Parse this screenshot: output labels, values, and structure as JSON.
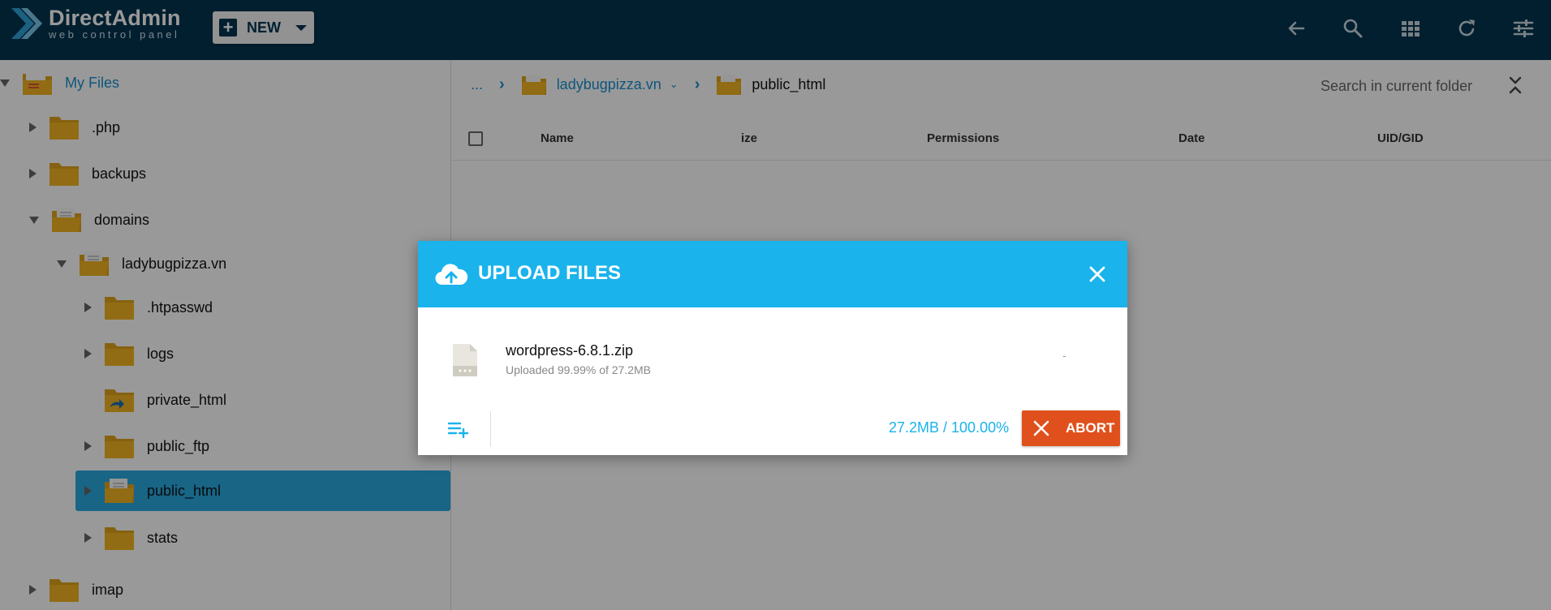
{
  "app": {
    "name": "DirectAdmin",
    "tagline": "web control panel",
    "new_button": "NEW"
  },
  "toolbar": {
    "icons": [
      "back-arrow-icon",
      "search-icon",
      "grid-view-icon",
      "refresh-icon",
      "settings-sliders-icon"
    ]
  },
  "sidebar": {
    "root": "My Files",
    "items": [
      {
        "label": ".php",
        "expanded": false
      },
      {
        "label": "backups",
        "expanded": false
      },
      {
        "label": "domains",
        "expanded": true
      },
      {
        "label": "ladybugpizza.vn",
        "expanded": true
      },
      {
        "label": ".htpasswd",
        "expanded": false
      },
      {
        "label": "logs",
        "expanded": false
      },
      {
        "label": "private_html",
        "expanded": false
      },
      {
        "label": "public_ftp",
        "expanded": false
      },
      {
        "label": "public_html",
        "selected": true
      },
      {
        "label": "stats",
        "expanded": false
      },
      {
        "label": "imap",
        "expanded": false
      }
    ]
  },
  "breadcrumb": {
    "ellipsis": "...",
    "parent": "ladybugpizza.vn",
    "current": "public_html"
  },
  "search": {
    "placeholder": "Search in current folder"
  },
  "table": {
    "columns": [
      "Name",
      "ize",
      "Permissions",
      "Date",
      "UID/GID"
    ]
  },
  "upload_dialog": {
    "title": "UPLOAD FILES",
    "file_name": "wordpress-6.8.1.zip",
    "file_status": "Uploaded 99.99% of 27.2MB",
    "file_dash": "-",
    "progress_text": "27.2MB / 100.00%",
    "abort_label": "ABORT"
  },
  "colors": {
    "topbar": "#02344f",
    "accent": "#1ab3eb",
    "link": "#1a8fd0",
    "abort": "#e0501c",
    "selected": "#28a9e0",
    "folder": "#f2b522"
  }
}
